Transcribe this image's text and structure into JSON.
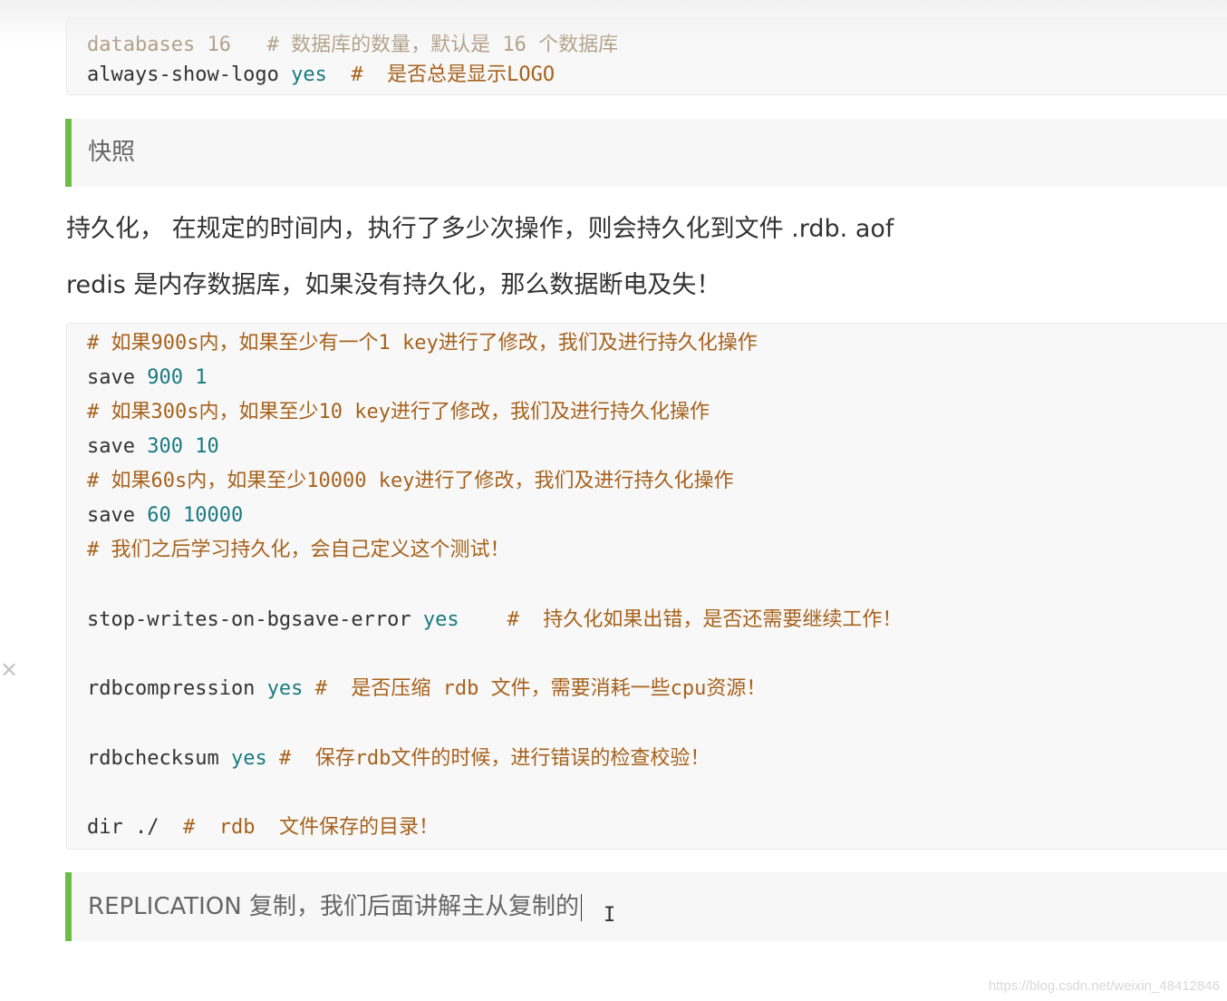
{
  "top_code": {
    "partial_line": "databases 16   # 数据库的数量，默认是 16 个数据库",
    "line_key": "always-show-logo",
    "line_val": "yes",
    "line_comment": "#  是否总是显示LOGO"
  },
  "snapshot_heading": "快照",
  "paragraph1": "持久化， 在规定的时间内，执行了多少次操作，则会持久化到文件 .rdb. aof",
  "paragraph2": "redis 是内存数据库，如果没有持久化，那么数据断电及失！",
  "config_code": {
    "c1_hash": "#",
    "c1_text": " 如果900s内，如果至少有一个1 key进行了修改，我们及进行持久化操作",
    "l1_cmd": "save",
    "l1_args": "900 1",
    "c2_hash": "#",
    "c2_text": " 如果300s内，如果至少10 key进行了修改，我们及进行持久化操作",
    "l2_cmd": "save",
    "l2_args": "300 10",
    "c3_hash": "#",
    "c3_text": " 如果60s内，如果至少10000 key进行了修改，我们及进行持久化操作",
    "l3_cmd": "save",
    "l3_args": "60 10000",
    "c4_hash": "#",
    "c4_text": " 我们之后学习持久化，会自己定义这个测试！",
    "stop_key": "stop-writes-on-bgsave-error",
    "stop_val": "yes",
    "stop_comment": "#  持久化如果出错，是否还需要继续工作！",
    "comp_key": "rdbcompression",
    "comp_val": "yes",
    "comp_comment": "#  是否压缩 rdb 文件，需要消耗一些cpu资源！",
    "check_key": "rdbchecksum",
    "check_val": "yes",
    "check_comment": "#  保存rdb文件的时候，进行错误的检查校验！",
    "dir_key": "dir ./",
    "dir_comment": "#  rdb  文件保存的目录！"
  },
  "replication_heading": "REPLICATION 复制，我们后面讲解主从复制的",
  "watermark": "https://blog.csdn.net/weixin_48412846",
  "colors": {
    "accent_green": "#6cbd45",
    "keyword": "#1a7a82",
    "comment": "#a6621c"
  }
}
